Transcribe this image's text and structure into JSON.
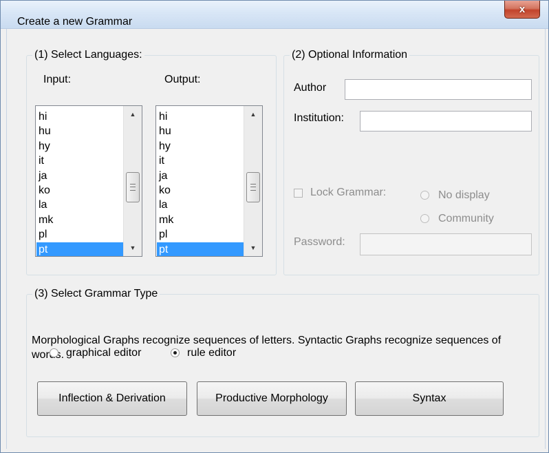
{
  "window": {
    "title": "Create a new Grammar",
    "close_label": "x"
  },
  "languages": {
    "group_title": "(1) Select Languages:",
    "input_label": "Input:",
    "output_label": "Output:",
    "input_items": [
      "hi",
      "hu",
      "hy",
      "it",
      "ja",
      "ko",
      "la",
      "mk",
      "pl",
      "pt"
    ],
    "output_items": [
      "hi",
      "hu",
      "hy",
      "it",
      "ja",
      "ko",
      "la",
      "mk",
      "pl",
      "pt"
    ],
    "selected_input": "pt",
    "selected_output": "pt"
  },
  "optional": {
    "group_title": "(2) Optional Information",
    "author_label": "Author",
    "author_value": "",
    "institution_label": "Institution:",
    "institution_value": "",
    "lock_label": "Lock Grammar:",
    "radio_no_display": "No display",
    "radio_community": "Community",
    "password_label": "Password:",
    "password_value": ""
  },
  "grammar_type": {
    "group_title": "(3) Select Grammar Type",
    "description": "Morphological Graphs recognize sequences of letters. Syntactic Graphs recognize sequences of words.",
    "radio_graphical": "graphical editor",
    "radio_rule": "rule editor",
    "selected_editor": "rule editor",
    "buttons": {
      "inflection": "Inflection & Derivation",
      "productive": "Productive Morphology",
      "syntax": "Syntax"
    }
  },
  "colors": {
    "selection": "#3399ff",
    "close_button": "#c2432b",
    "window_frame": "#dfe9f5"
  }
}
